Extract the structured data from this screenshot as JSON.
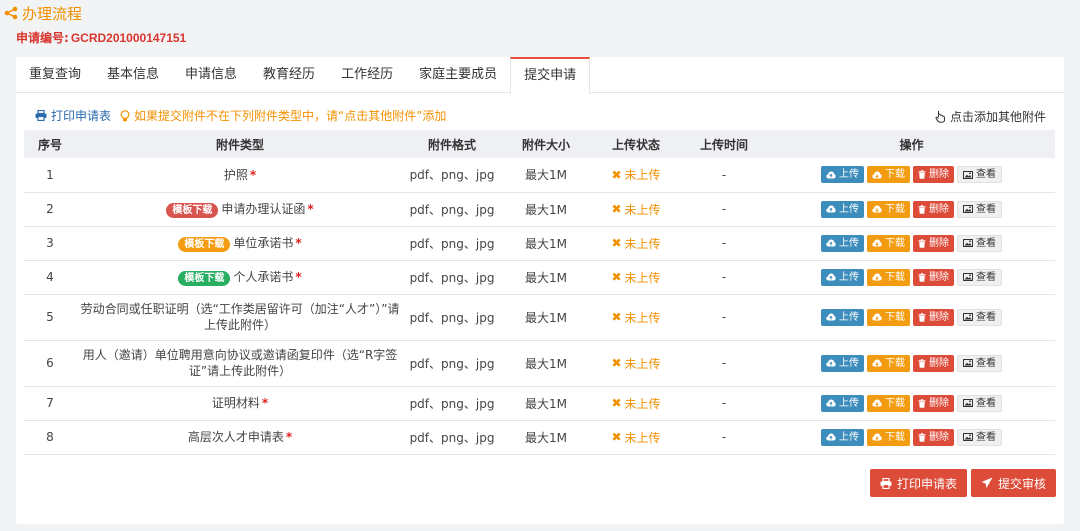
{
  "header": {
    "title": "办理流程",
    "app_no_label": "申请编号:",
    "app_no_value": "GCRD201000147151"
  },
  "tabs": [
    {
      "label": "重复查询"
    },
    {
      "label": "基本信息"
    },
    {
      "label": "申请信息"
    },
    {
      "label": "教育经历"
    },
    {
      "label": "工作经历"
    },
    {
      "label": "家庭主要成员"
    },
    {
      "label": "提交申请",
      "active": true
    }
  ],
  "toolbar": {
    "print_label": "打印申请表",
    "notice": "如果提交附件不在下列附件类型中，请“点击其他附件”添加",
    "add_other_label": "点击添加其他附件"
  },
  "table": {
    "headers": [
      "序号",
      "附件类型",
      "附件格式",
      "附件大小",
      "上传状态",
      "上传时间",
      "操作"
    ],
    "rows": [
      {
        "no": "1",
        "type": "护照",
        "format": "pdf、png、jpg",
        "size": "最大1M",
        "status": "未上传",
        "time": "-"
      },
      {
        "no": "2",
        "badge": "模板下载",
        "type": "申请办理认证函",
        "format": "pdf、png、jpg",
        "size": "最大1M",
        "status": "未上传",
        "time": "-"
      },
      {
        "no": "3",
        "badge": "模板下载",
        "type": "单位承诺书",
        "format": "pdf、png、jpg",
        "size": "最大1M",
        "status": "未上传",
        "time": "-"
      },
      {
        "no": "4",
        "badge": "模板下载",
        "type": "个人承诺书",
        "format": "pdf、png、jpg",
        "size": "最大1M",
        "status": "未上传",
        "time": "-"
      },
      {
        "no": "5",
        "type": "劳动合同或任职证明（选“工作类居留许可（加注“人才”）”请上传此附件）",
        "format": "pdf、png、jpg",
        "size": "最大1M",
        "status": "未上传",
        "time": "-"
      },
      {
        "no": "6",
        "type": "用人（邀请）单位聘用意向协议或邀请函复印件（选“R字签证”请上传此附件）",
        "format": "pdf、png、jpg",
        "size": "最大1M",
        "status": "未上传",
        "time": "-"
      },
      {
        "no": "7",
        "type": "证明材料",
        "format": "pdf、png、jpg",
        "size": "最大1M",
        "status": "未上传",
        "time": "-"
      },
      {
        "no": "8",
        "type": "高层次人才申请表",
        "format": "pdf、png、jpg",
        "size": "最大1M",
        "status": "未上传",
        "time": "-"
      }
    ],
    "ops": {
      "upload": "上传",
      "download": "下载",
      "delete": "删除",
      "view": "查看"
    }
  },
  "actions": {
    "print_label": "打印申请表",
    "submit_label": "提交审核"
  },
  "colors": {
    "accent_orange": "#f29100",
    "accent_red": "#dd4b39",
    "upload_blue": "#3c8dbc",
    "badge_red": "#d9534f",
    "badge_orange": "#f39c12",
    "badge_green": "#27ae60"
  },
  "icons": {
    "title": "share-icon",
    "print": "print-icon",
    "notice": "lightbulb-icon",
    "add_other": "hand-pointer-icon",
    "status": "times-icon",
    "upload": "cloud-upload-icon",
    "download": "cloud-download-icon",
    "delete": "trash-icon",
    "view": "image-icon",
    "submit": "paper-plane-icon"
  }
}
